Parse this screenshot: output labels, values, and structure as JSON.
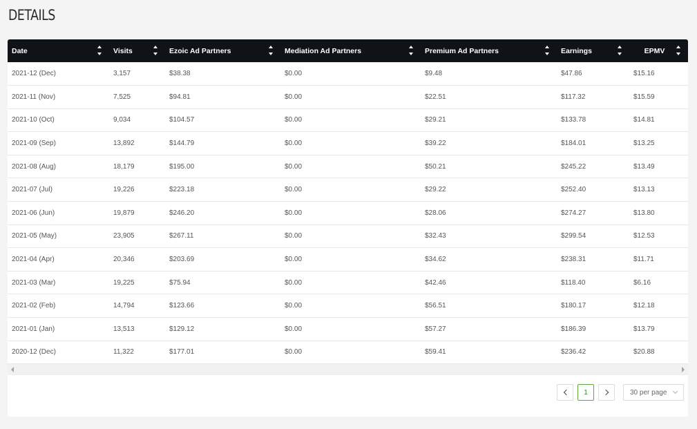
{
  "page": {
    "title": "DETAILS"
  },
  "table": {
    "columns": [
      "Date",
      "Visits",
      "Ezoic Ad Partners",
      "Mediation Ad Partners",
      "Premium Ad Partners",
      "Earnings",
      "EPMV"
    ],
    "rows": [
      [
        "2021-12 (Dec)",
        "3,157",
        "$38.38",
        "$0.00",
        "$9.48",
        "$47.86",
        "$15.16"
      ],
      [
        "2021-11 (Nov)",
        "7,525",
        "$94.81",
        "$0.00",
        "$22.51",
        "$117.32",
        "$15.59"
      ],
      [
        "2021-10 (Oct)",
        "9,034",
        "$104.57",
        "$0.00",
        "$29.21",
        "$133.78",
        "$14.81"
      ],
      [
        "2021-09 (Sep)",
        "13,892",
        "$144.79",
        "$0.00",
        "$39.22",
        "$184.01",
        "$13.25"
      ],
      [
        "2021-08 (Aug)",
        "18,179",
        "$195.00",
        "$0.00",
        "$50.21",
        "$245.22",
        "$13.49"
      ],
      [
        "2021-07 (Jul)",
        "19,226",
        "$223.18",
        "$0.00",
        "$29.22",
        "$252.40",
        "$13.13"
      ],
      [
        "2021-06 (Jun)",
        "19,879",
        "$246.20",
        "$0.00",
        "$28.06",
        "$274.27",
        "$13.80"
      ],
      [
        "2021-05 (May)",
        "23,905",
        "$267.11",
        "$0.00",
        "$32.43",
        "$299.54",
        "$12.53"
      ],
      [
        "2021-04 (Apr)",
        "20,346",
        "$203.69",
        "$0.00",
        "$34.62",
        "$238.31",
        "$11.71"
      ],
      [
        "2021-03 (Mar)",
        "19,225",
        "$75.94",
        "$0.00",
        "$42.46",
        "$118.40",
        "$6.16"
      ],
      [
        "2021-02 (Feb)",
        "14,794",
        "$123.66",
        "$0.00",
        "$56.51",
        "$180.17",
        "$12.18"
      ],
      [
        "2021-01 (Jan)",
        "13,513",
        "$129.12",
        "$0.00",
        "$57.27",
        "$186.39",
        "$13.79"
      ],
      [
        "2020-12 (Dec)",
        "11,322",
        "$177.01",
        "$0.00",
        "$59.41",
        "$236.42",
        "$20.88"
      ]
    ]
  },
  "pagination": {
    "current_page": "1",
    "per_page": "30 per page"
  },
  "icons": {
    "sort": "sort-icon",
    "prev": "chevron-left-icon",
    "next": "chevron-right-icon",
    "dropdown": "chevron-down-icon"
  },
  "colors": {
    "header_bg": "#0f1217",
    "page_bg": "#f4f4f5",
    "active_page": "#5aa53c"
  }
}
